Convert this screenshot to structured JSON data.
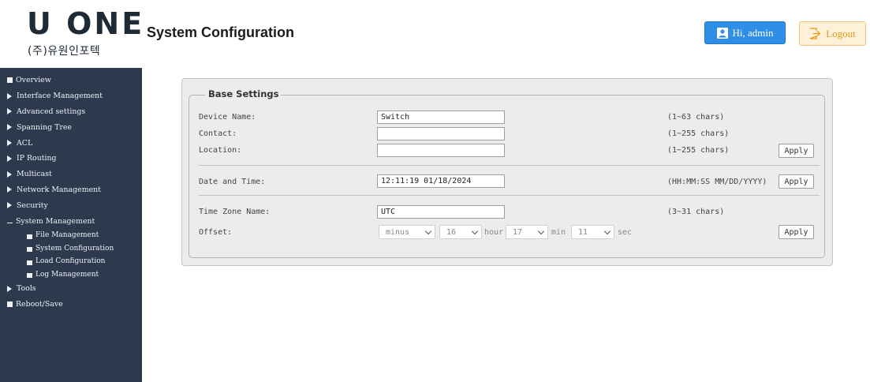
{
  "header": {
    "logo_main": "U ONE",
    "logo_sub": "(주)유원인포텍",
    "title": "System Configuration",
    "admin_label": "Hi, admin",
    "logout_label": "Logout"
  },
  "sidebar": {
    "items": [
      {
        "label": "Overview"
      },
      {
        "label": "Interface Management"
      },
      {
        "label": "Advanced settings"
      },
      {
        "label": "Spanning Tree"
      },
      {
        "label": "ACL"
      },
      {
        "label": "IP Routing"
      },
      {
        "label": "Multicast"
      },
      {
        "label": "Network Management"
      },
      {
        "label": "Security"
      },
      {
        "label": "System Management"
      },
      {
        "label": "File Management"
      },
      {
        "label": "System Configuration"
      },
      {
        "label": "Load Configuration"
      },
      {
        "label": "Log Management"
      },
      {
        "label": "Tools"
      },
      {
        "label": "Reboot/Save"
      }
    ]
  },
  "base_settings": {
    "legend": "Base Settings",
    "device_name": {
      "label": "Device Name:",
      "value": "Switch",
      "hint": "(1~63 chars)"
    },
    "contact": {
      "label": "Contact:",
      "value": "",
      "hint": "(1~255 chars)"
    },
    "location": {
      "label": "Location:",
      "value": "",
      "hint": "(1~255 chars)"
    },
    "apply_label": "Apply",
    "date_time": {
      "label": "Date and Time:",
      "value": "12:11:19 01/18/2024",
      "hint": "(HH:MM:SS MM/DD/YYYY)"
    },
    "time_zone": {
      "label": "Time Zone Name:",
      "value": "UTC",
      "hint": "(3~31 chars)"
    },
    "offset": {
      "label": "Offset:",
      "sign": "minus",
      "hour_value": "16",
      "hour_unit": "hour",
      "min_value": "17",
      "min_unit": "min",
      "sec_value": "11",
      "sec_unit": "sec"
    }
  },
  "colors": {
    "sidebar_bg": "#2d3a4e",
    "admin_button": "#2f8ee6",
    "logout_button_bg": "#fdf1d8",
    "logout_button_text": "#e69a1a",
    "panel_bg": "#ececec"
  },
  "icons": {
    "admin": "user-icon",
    "logout": "logout-icon"
  }
}
